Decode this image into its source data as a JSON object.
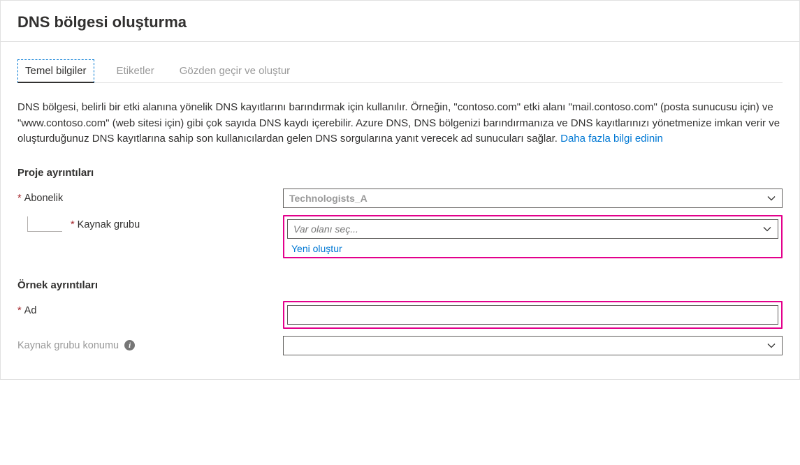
{
  "header": {
    "title": "DNS bölgesi oluşturma"
  },
  "tabs": {
    "basics": "Temel bilgiler",
    "tags": "Etiketler",
    "review": "Gözden geçir ve oluştur"
  },
  "description": {
    "text": "DNS bölgesi, belirli bir etki alanına yönelik DNS kayıtlarını barındırmak için kullanılır. Örneğin, \"contoso.com\" etki alanı \"mail.contoso.com\" (posta sunucusu için) ve \"www.contoso.com\" (web sitesi için) gibi çok sayıda DNS kaydı içerebilir. Azure DNS, DNS bölgenizi barındırmanıza ve DNS kayıtlarınızı yönetmenize imkan verir ve oluşturduğunuz DNS kayıtlarına sahip son kullanıcılardan gelen DNS sorgularına yanıt verecek ad sunucuları sağlar. ",
    "learn_more": "Daha fazla bilgi edinin"
  },
  "sections": {
    "project": "Proje ayrıntıları",
    "instance": "Örnek ayrıntıları"
  },
  "fields": {
    "subscription": {
      "label": "Abonelik",
      "value": "Technologists_A"
    },
    "resource_group": {
      "label": "Kaynak grubu",
      "placeholder": "Var olanı seç...",
      "create_new": "Yeni oluştur"
    },
    "name": {
      "label": "Ad",
      "value": ""
    },
    "location": {
      "label": "Kaynak grubu konumu",
      "value": ""
    }
  }
}
